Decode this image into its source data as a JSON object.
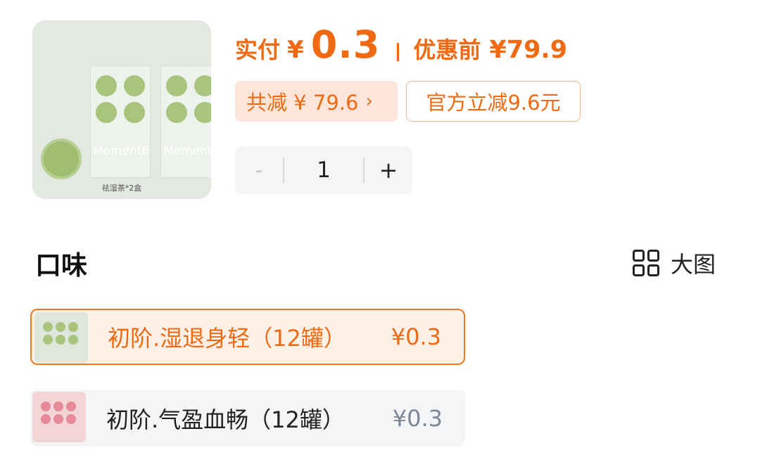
{
  "product": {
    "image_caption": "祛湿茶*2盒",
    "brand_text": "Moment6"
  },
  "price": {
    "pay_label": "实付",
    "pay_currency": "¥",
    "pay_value": "0.3",
    "before_label": "优惠前",
    "before_value": "¥79.9"
  },
  "discounts": {
    "total_label": "共减 ¥ 79.6",
    "total_chevron": "›",
    "official_label": "官方立减9.6元"
  },
  "stepper": {
    "minus": "-",
    "quantity": "1",
    "plus": "+"
  },
  "flavor": {
    "title": "口味",
    "big_view_label": "大图",
    "options": [
      {
        "name": "初阶.湿退身轻（12罐）",
        "price": "¥0.3",
        "selected": true
      },
      {
        "name": "初阶.气盈血畅（12罐）",
        "price": "¥0.3",
        "selected": false
      }
    ]
  },
  "colors": {
    "accent": "#f06a13",
    "badge_bg": "#fde6d9",
    "muted_price": "#7d8597",
    "stepper_bg": "#f4f5f7"
  }
}
